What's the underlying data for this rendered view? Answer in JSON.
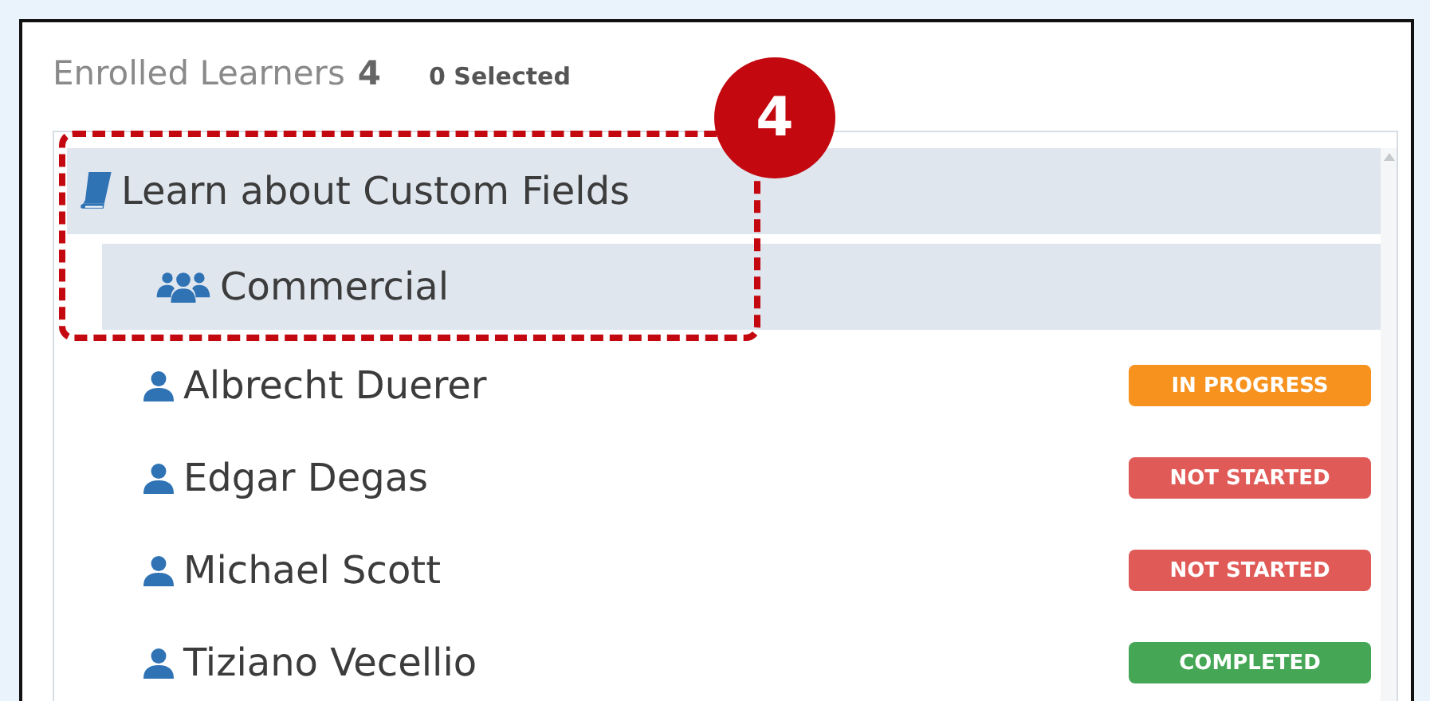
{
  "header": {
    "title": "Enrolled Learners",
    "count": "4",
    "selected": "0 Selected"
  },
  "course": {
    "title": "Learn about Custom Fields",
    "children": [
      {
        "group": "Commercial",
        "learners": [
          {
            "name": "Albrecht Duerer",
            "status": "IN PROGRESS",
            "color": "#f7921e"
          },
          {
            "name": "Edgar Degas",
            "status": "NOT STARTED",
            "color": "#e05a57"
          },
          {
            "name": "Michael Scott",
            "status": "NOT STARTED",
            "color": "#e05a57"
          },
          {
            "name": "Tiziano Vecellio",
            "status": "COMPLETED",
            "color": "#45a755"
          }
        ]
      }
    ]
  },
  "callout": {
    "number": "4"
  }
}
